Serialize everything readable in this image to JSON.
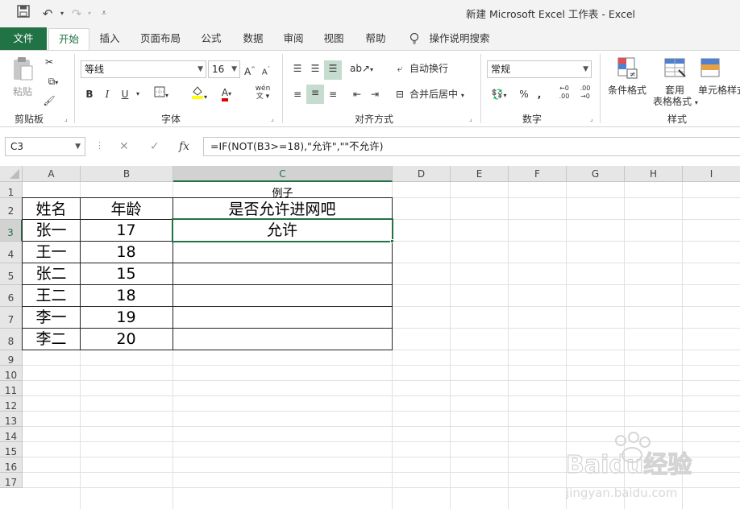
{
  "window": {
    "title": "新建 Microsoft Excel 工作表  -  Excel"
  },
  "quick_access": {
    "save": "save-icon",
    "undo": "undo-icon",
    "redo": "redo-icon",
    "customize": "customize-icon"
  },
  "tabs": [
    "文件",
    "开始",
    "插入",
    "页面布局",
    "公式",
    "数据",
    "审阅",
    "视图",
    "帮助",
    "操作说明搜索"
  ],
  "ribbon": {
    "clipboard": {
      "paste": "粘贴",
      "label": "剪贴板"
    },
    "font": {
      "name": "等线",
      "size": "16",
      "grow": "A",
      "shrink": "A",
      "bold": "B",
      "italic": "I",
      "underline": "U",
      "font_color_glyph": "A",
      "phonetic": "wén",
      "label": "字体"
    },
    "alignment": {
      "wrap": "自动换行",
      "merge": "合并后居中",
      "label": "对齐方式"
    },
    "number": {
      "format": "常规",
      "percent": "%",
      "comma": ",",
      "inc_dec": ".0",
      "label": "数字"
    },
    "styles": {
      "conditional": "条件格式",
      "table1": "套用",
      "table2": "表格格式",
      "cell_styles": "单元格样式",
      "label": "样式"
    }
  },
  "formula_bar": {
    "name_box": "C3",
    "fx": "fx",
    "formula": "=IF(NOT(B3>=18),\"允许\",\"\"不允许)"
  },
  "columns": [
    "A",
    "B",
    "C",
    "D",
    "E",
    "F",
    "G",
    "H",
    "I"
  ],
  "rows": [
    "1",
    "2",
    "3",
    "4",
    "5",
    "6",
    "7",
    "8",
    "9",
    "10",
    "11",
    "12",
    "13",
    "14",
    "15",
    "16",
    "17"
  ],
  "active": {
    "col": "C",
    "row": "3"
  },
  "sheet": {
    "c1": "例子",
    "headers": [
      "姓名",
      "年龄",
      "是否允许进网吧"
    ],
    "data": [
      [
        "张一",
        "17",
        "允许"
      ],
      [
        "王一",
        "18",
        ""
      ],
      [
        "张二",
        "15",
        ""
      ],
      [
        "王二",
        "18",
        ""
      ],
      [
        "李一",
        "19",
        ""
      ],
      [
        "李二",
        "20",
        ""
      ]
    ]
  },
  "watermark": {
    "text": "Baidu经验",
    "url": "jingyan.baidu.com"
  },
  "colors": {
    "excel_green": "#217346",
    "header_bg": "#e6e6e6"
  }
}
